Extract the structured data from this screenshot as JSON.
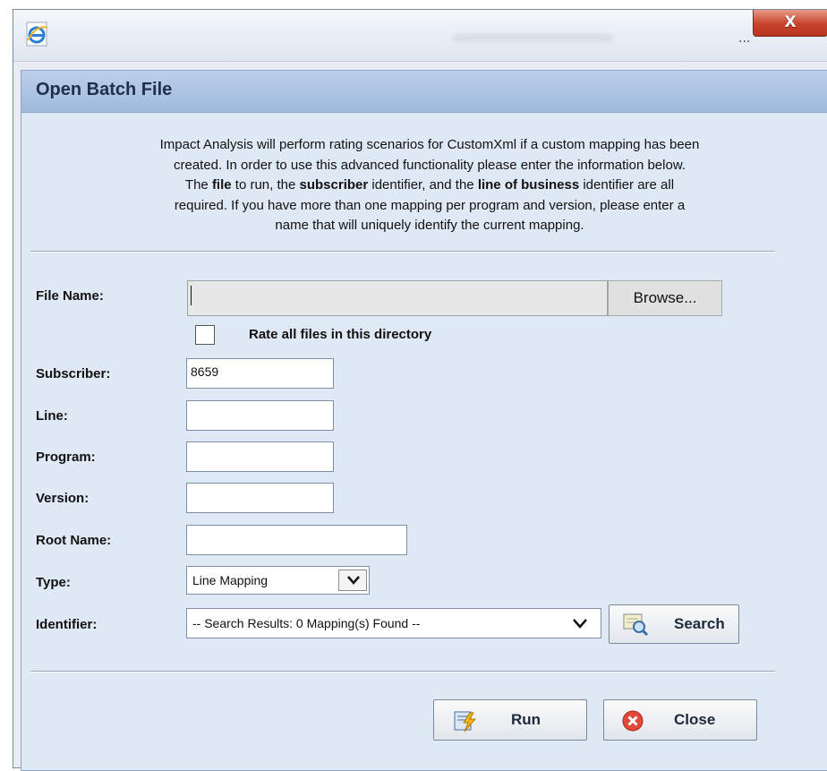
{
  "window": {
    "ellipsis": "...",
    "close_symbol": "X"
  },
  "panel": {
    "title": "Open Batch File",
    "description_lines": [
      "Impact Analysis will perform rating scenarios for CustomXml if a custom mapping has been",
      "created. In order to use this advanced functionality please enter the information below.",
      "required. If you have more than one mapping per program and version, please enter a",
      "name that will uniquely identify the current mapping."
    ],
    "description_line3": {
      "t1": "The ",
      "b1": "file",
      "t2": " to run, the ",
      "b2": "subscriber",
      "t3": " identifier, and the ",
      "b3": "line of business",
      "t4": " identifier are all"
    }
  },
  "form": {
    "file_name_label": "File Name:",
    "file_name_value": "",
    "browse_label": "Browse...",
    "rate_all_label": "Rate all files in this directory",
    "rate_all_checked": false,
    "subscriber_label": "Subscriber:",
    "subscriber_value": "8659",
    "line_label": "Line:",
    "line_value": "",
    "program_label": "Program:",
    "program_value": "",
    "version_label": "Version:",
    "version_value": "",
    "root_name_label": "Root Name:",
    "root_name_value": "",
    "type_label": "Type:",
    "type_value": "Line Mapping",
    "identifier_label": "Identifier:",
    "identifier_value": "-- Search Results: 0 Mapping(s) Found --",
    "search_button": "Search"
  },
  "footer": {
    "run_button": "Run",
    "close_button": "Close"
  },
  "colors": {
    "panel_header": "#a9c1e1",
    "panel_bg": "#dfe9f5",
    "close_red": "#c7432a"
  },
  "icons": [
    "ie-icon",
    "close-x-icon",
    "dropdown-arrow-icon",
    "search-icon",
    "run-icon",
    "close-circle-icon"
  ]
}
